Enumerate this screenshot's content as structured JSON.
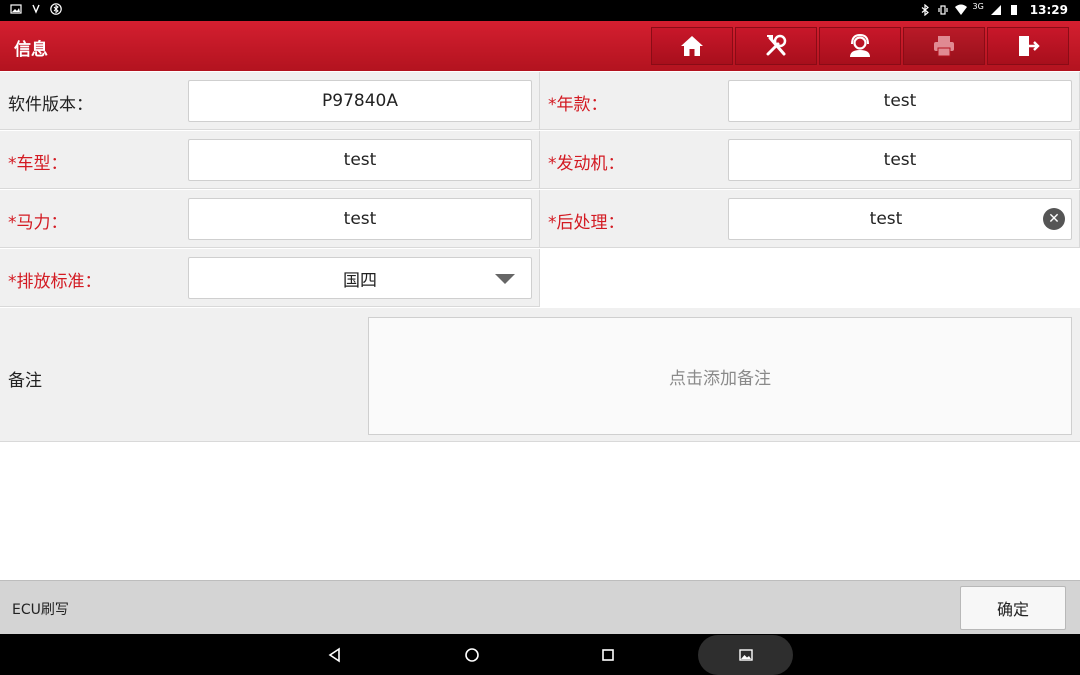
{
  "status_bar": {
    "time": "13:29",
    "network": "3G"
  },
  "header": {
    "title": "信息",
    "buttons": [
      {
        "icon": "home-icon"
      },
      {
        "icon": "tools-icon"
      },
      {
        "icon": "support-agent-icon"
      },
      {
        "icon": "print-icon"
      },
      {
        "icon": "exit-icon"
      }
    ]
  },
  "form": {
    "software_version": {
      "label": "软件版本：",
      "value": "P97840A"
    },
    "year": {
      "label": "*年款：",
      "value": "test"
    },
    "model": {
      "label": "*车型：",
      "value": "test"
    },
    "engine": {
      "label": "*发动机：",
      "value": "test"
    },
    "horsepower": {
      "label": "*马力：",
      "value": "test"
    },
    "aftertreatment": {
      "label": "*后处理：",
      "value": "test"
    },
    "emission": {
      "label": "*排放标准：",
      "value": "国四"
    }
  },
  "notes": {
    "label": "备注",
    "placeholder": "点击添加备注"
  },
  "footer": {
    "breadcrumb": "ECU刷写",
    "confirm_label": "确定"
  },
  "colors": {
    "header_red": "#c8172a",
    "required_red": "#d31a22"
  }
}
